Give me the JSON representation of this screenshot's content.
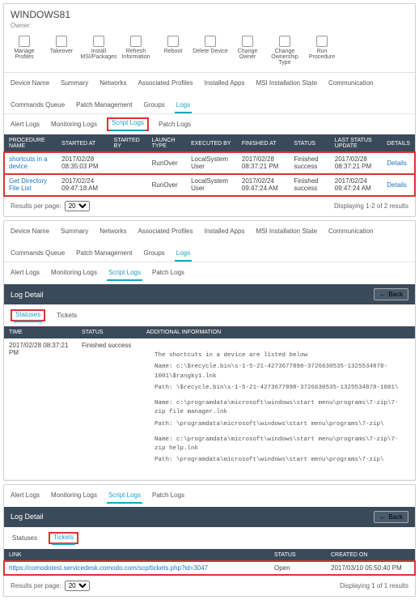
{
  "device": {
    "title": "WINDOWS81",
    "owner_label": "Owner:"
  },
  "toolbar": [
    {
      "name": "manage-profiles",
      "label": "Manage Profiles"
    },
    {
      "name": "takeover",
      "label": "Takeover"
    },
    {
      "name": "install-msi",
      "label": "Install MSI/Packages"
    },
    {
      "name": "refresh-info",
      "label": "Refresh Information"
    },
    {
      "name": "reboot",
      "label": "Reboot"
    },
    {
      "name": "delete-device",
      "label": "Delete Device"
    },
    {
      "name": "change-owner",
      "label": "Change Owner"
    },
    {
      "name": "change-ownership-type",
      "label": "Change Ownership Type"
    },
    {
      "name": "run-procedure",
      "label": "Run Procedure"
    }
  ],
  "tabs1": [
    "Device Name",
    "Summary",
    "Networks",
    "Associated Profiles",
    "Installed Apps",
    "MSI Installation State",
    "Communication",
    "Commands Queue",
    "Patch Management",
    "Groups",
    "Logs"
  ],
  "subtabs1": [
    "Alert Logs",
    "Monitoring Logs",
    "Script Logs",
    "Patch Logs"
  ],
  "procTable": {
    "headers": [
      "PROCEDURE NAME",
      "STARTED AT",
      "STARTED BY",
      "LAUNCH TYPE",
      "EXECUTED BY",
      "FINISHED AT",
      "STATUS",
      "LAST STATUS UPDATE",
      "DETAILS"
    ],
    "rows": [
      {
        "name": "shortcuts in a device",
        "started": "2017/02/28 08:35:03 PM",
        "by": "",
        "launch": "RunOver",
        "exec": "LocalSystem User",
        "finished": "2017/02/28 08:37:21 PM",
        "status": "Finished success",
        "update": "2017/02/28 08:37:21 PM",
        "details": "Details"
      },
      {
        "name": "Get Directory File List",
        "started": "2017/02/24 09:47:18 AM",
        "by": "",
        "launch": "RunOver",
        "exec": "LocalSystem User",
        "finished": "2017/02/24 09:47:24 AM",
        "status": "Finished success",
        "update": "2017/02/24 09:47:24 AM",
        "details": "Details"
      }
    ]
  },
  "pager1": {
    "label": "Results per page:",
    "value": "20",
    "info": "Displaying 1-2 of 2 results"
  },
  "section2": {
    "tabs": [
      "Device Name",
      "Summary",
      "Networks",
      "Associated Profiles",
      "Installed Apps",
      "MSI Installation State",
      "Communication",
      "Commands Queue",
      "Patch Management",
      "Groups",
      "Logs"
    ],
    "subtabs": [
      "Alert Logs",
      "Monitoring Logs",
      "Script Logs",
      "Patch Logs"
    ]
  },
  "logDetail1": {
    "title": "Log Detail",
    "back": "Back",
    "mt": [
      "Statuses",
      "Tickets"
    ],
    "headers": [
      "TIME",
      "STATUS",
      "ADDITIONAL INFORMATION"
    ],
    "time": "2017/02/28 08:37:21 PM",
    "status": "Finished success",
    "body": [
      "The shortcuts in a device are listed below",
      "Name:  c:\\$recycle.bin\\s-1-5-21-4273677898-3726630535-1325534878-1001\\$rangky1.lnk",
      "Path:  \\$recycle.bin\\s-1-5-21-4273677898-3726630535-1325534878-1001\\",
      "Name:  c:\\programdata\\microsoft\\windows\\start menu\\programs\\7-zip\\7-zip file manager.lnk",
      "Path:  \\programdata\\microsoft\\windows\\start menu\\programs\\7-zip\\",
      "Name:  c:\\programdata\\microsoft\\windows\\start menu\\programs\\7-zip\\7-zip help.lnk",
      "Path:  \\programdata\\microsoft\\windows\\start menu\\programs\\7-zip\\"
    ]
  },
  "section3": {
    "subtabs": [
      "Alert Logs",
      "Monitoring Logs",
      "Script Logs",
      "Patch Logs"
    ]
  },
  "logDetail2": {
    "title": "Log Detail",
    "back": "Back",
    "mt": [
      "Statuses",
      "Tickets"
    ],
    "headers": [
      "LINK",
      "STATUS",
      "CREATED ON"
    ],
    "row": {
      "link": "https://comodotest.servicedesk.comodo.com/scp/tickets.php?id=3047",
      "status": "Open",
      "created": "2017/03/10 05:50:40 PM"
    }
  },
  "pager2": {
    "label": "Results per page:",
    "value": "20",
    "info": "Displaying 1 of 1 results"
  }
}
